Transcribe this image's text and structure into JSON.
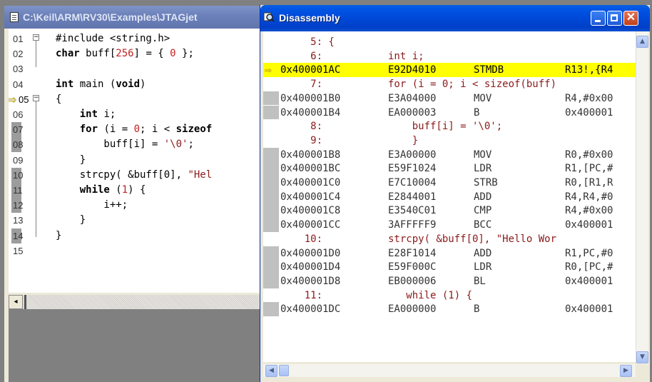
{
  "editor": {
    "title": "C:\\Keil\\ARM\\RV30\\Examples\\JTAGjet",
    "lines": [
      {
        "num": "01",
        "segments": [
          {
            "t": "#include <string.h>",
            "c": ""
          }
        ]
      },
      {
        "num": "02",
        "segments": [
          {
            "t": "char",
            "c": "kw"
          },
          {
            "t": " buff[",
            "c": ""
          },
          {
            "t": "256",
            "c": "num"
          },
          {
            "t": "] = { ",
            "c": ""
          },
          {
            "t": "0",
            "c": "num"
          },
          {
            "t": " };",
            "c": ""
          }
        ]
      },
      {
        "num": "03",
        "segments": []
      },
      {
        "num": "04",
        "segments": [
          {
            "t": "int",
            "c": "kw"
          },
          {
            "t": " main (",
            "c": ""
          },
          {
            "t": "void",
            "c": "kw"
          },
          {
            "t": ")",
            "c": ""
          }
        ]
      },
      {
        "num": "05",
        "segments": [
          {
            "t": "{",
            "c": ""
          }
        ]
      },
      {
        "num": "06",
        "segments": [
          {
            "t": "    ",
            "c": ""
          },
          {
            "t": "int",
            "c": "kw"
          },
          {
            "t": " i;",
            "c": ""
          }
        ]
      },
      {
        "num": "07",
        "segments": [
          {
            "t": "    ",
            "c": ""
          },
          {
            "t": "for",
            "c": "kw"
          },
          {
            "t": " (i = ",
            "c": ""
          },
          {
            "t": "0",
            "c": "num"
          },
          {
            "t": "; i < ",
            "c": ""
          },
          {
            "t": "sizeof",
            "c": "kw"
          }
        ]
      },
      {
        "num": "08",
        "segments": [
          {
            "t": "        buff[i] = ",
            "c": ""
          },
          {
            "t": "'\\0'",
            "c": "str"
          },
          {
            "t": ";",
            "c": ""
          }
        ]
      },
      {
        "num": "09",
        "segments": [
          {
            "t": "    }",
            "c": ""
          }
        ]
      },
      {
        "num": "10",
        "segments": [
          {
            "t": "    strcpy( &buff[0], ",
            "c": ""
          },
          {
            "t": "\"Hel",
            "c": "str"
          }
        ]
      },
      {
        "num": "11",
        "segments": [
          {
            "t": "    ",
            "c": ""
          },
          {
            "t": "while",
            "c": "kw"
          },
          {
            "t": " (",
            "c": ""
          },
          {
            "t": "1",
            "c": "num"
          },
          {
            "t": ") {",
            "c": ""
          }
        ]
      },
      {
        "num": "12",
        "segments": [
          {
            "t": "        i++;",
            "c": ""
          }
        ]
      },
      {
        "num": "13",
        "segments": [
          {
            "t": "    }",
            "c": ""
          }
        ]
      },
      {
        "num": "14",
        "segments": [
          {
            "t": "}",
            "c": ""
          }
        ]
      },
      {
        "num": "15",
        "segments": []
      }
    ]
  },
  "disassembly": {
    "title": "Disassembly",
    "lines": [
      {
        "type": "src",
        "c1": "     5: {",
        "c2": "",
        "c3": "",
        "c4": ""
      },
      {
        "type": "src",
        "c1": "     6:",
        "c2": "int i;",
        "c3": "",
        "c4": ""
      },
      {
        "type": "asm",
        "hl": true,
        "c1": "0x400001AC",
        "c2": "E92D4010",
        "c3": "STMDB",
        "c4": "R13!,{R4"
      },
      {
        "type": "src",
        "c1": "     7:",
        "c2": "for (i = 0; i < sizeof(buff)",
        "c3": "",
        "c4": ""
      },
      {
        "type": "asm",
        "c1": "0x400001B0",
        "c2": "E3A04000",
        "c3": "MOV",
        "c4": "R4,#0x00"
      },
      {
        "type": "asm",
        "c1": "0x400001B4",
        "c2": "EA000003",
        "c3": "B",
        "c4": "0x400001"
      },
      {
        "type": "src",
        "c1": "     8:",
        "c2": "    buff[i] = '\\0';",
        "c3": "",
        "c4": ""
      },
      {
        "type": "src",
        "c1": "     9:",
        "c2": "    }",
        "c3": "",
        "c4": ""
      },
      {
        "type": "asm",
        "c1": "0x400001B8",
        "c2": "E3A00000",
        "c3": "MOV",
        "c4": "R0,#0x00"
      },
      {
        "type": "asm",
        "c1": "0x400001BC",
        "c2": "E59F1024",
        "c3": "LDR",
        "c4": "R1,[PC,#"
      },
      {
        "type": "asm",
        "c1": "0x400001C0",
        "c2": "E7C10004",
        "c3": "STRB",
        "c4": "R0,[R1,R"
      },
      {
        "type": "asm",
        "c1": "0x400001C4",
        "c2": "E2844001",
        "c3": "ADD",
        "c4": "R4,R4,#0"
      },
      {
        "type": "asm",
        "c1": "0x400001C8",
        "c2": "E3540C01",
        "c3": "CMP",
        "c4": "R4,#0x00"
      },
      {
        "type": "asm",
        "c1": "0x400001CC",
        "c2": "3AFFFFF9",
        "c3": "BCC",
        "c4": "0x400001"
      },
      {
        "type": "src",
        "c1": "    10:",
        "c2": "strcpy( &buff[0], \"Hello Wor",
        "c3": "",
        "c4": ""
      },
      {
        "type": "asm",
        "c1": "0x400001D0",
        "c2": "E28F1014",
        "c3": "ADD",
        "c4": "R1,PC,#0"
      },
      {
        "type": "asm",
        "c1": "0x400001D4",
        "c2": "E59F000C",
        "c3": "LDR",
        "c4": "R0,[PC,#"
      },
      {
        "type": "asm",
        "c1": "0x400001D8",
        "c2": "EB000006",
        "c3": "BL",
        "c4": "0x400001"
      },
      {
        "type": "src",
        "c1": "    11:",
        "c2": "   while (1) {",
        "c3": "",
        "c4": ""
      },
      {
        "type": "asm",
        "c1": "0x400001DC",
        "c2": "EA000000",
        "c3": "B",
        "c4": "0x400001"
      }
    ]
  },
  "icons": {
    "editor_title": "document-icon",
    "disassembly_title": "magnifier-icon",
    "current_line": "yellow-arrow-icon"
  },
  "colors": {
    "highlight": "#ffff00",
    "source_line": "#8b1a1a",
    "active_titlebar": "#0048d8",
    "inactive_titlebar": "#6b80b9"
  }
}
